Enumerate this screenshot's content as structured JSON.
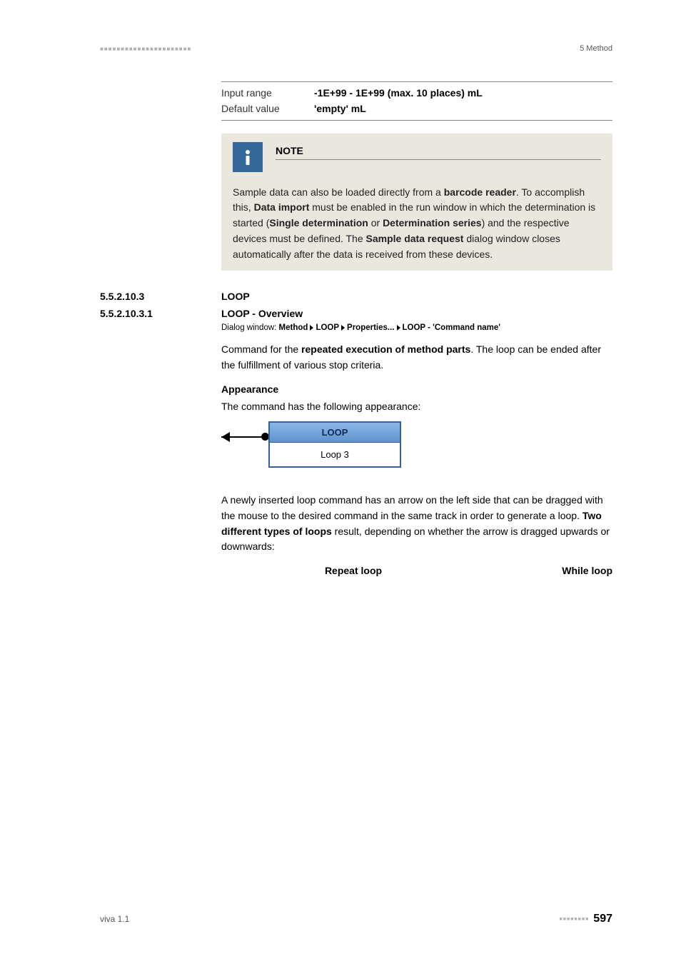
{
  "header": {
    "right": "5 Method"
  },
  "param": {
    "input_range_label": "Input range",
    "input_range_value": "-1E+99 - 1E+99 (max. 10 places) mL",
    "default_value_label": "Default value",
    "default_value_value": "'empty' mL"
  },
  "note": {
    "title": "NOTE",
    "body_parts": {
      "t1": "Sample data can also be loaded directly from a ",
      "b1": "barcode reader",
      "t2": ". To accomplish this, ",
      "b2": "Data import",
      "t3": " must be enabled in the run window in which the determination is started (",
      "b3": "Single determination",
      "t4": " or ",
      "b4": "Determination series",
      "t5": ") and the respective devices must be defined. The ",
      "b5": "Sample data request",
      "t6": " dialog window closes automatically after the data is received from these devices."
    }
  },
  "sections": {
    "s1_num": "5.5.2.10.3",
    "s1_title": "LOOP",
    "s2_num": "5.5.2.10.3.1",
    "s2_title": "LOOP - Overview"
  },
  "dialog": {
    "prefix": "Dialog window: ",
    "p1": "Method",
    "p2": "LOOP",
    "p3": "Properties...",
    "p4": "LOOP - 'Command name'"
  },
  "body": {
    "intro_t1": "Command for the ",
    "intro_b1": "repeated execution of method parts",
    "intro_t2": ". The loop can be ended after the fulfillment of various stop criteria.",
    "appearance_head": "Appearance",
    "appearance_text": "The command has the following appearance:",
    "loop_header": "LOOP",
    "loop_body": "Loop 3",
    "after_img_t1": "A newly inserted loop command has an arrow on the left side that can be dragged with the mouse to the desired command in the same track in order to generate a loop. ",
    "after_img_b1": "Two different types of loops",
    "after_img_t2": " result, depending on whether the arrow is dragged upwards or downwards:",
    "type_repeat": "Repeat loop",
    "type_while": "While loop"
  },
  "footer": {
    "left": "viva 1.1",
    "page": "597"
  }
}
